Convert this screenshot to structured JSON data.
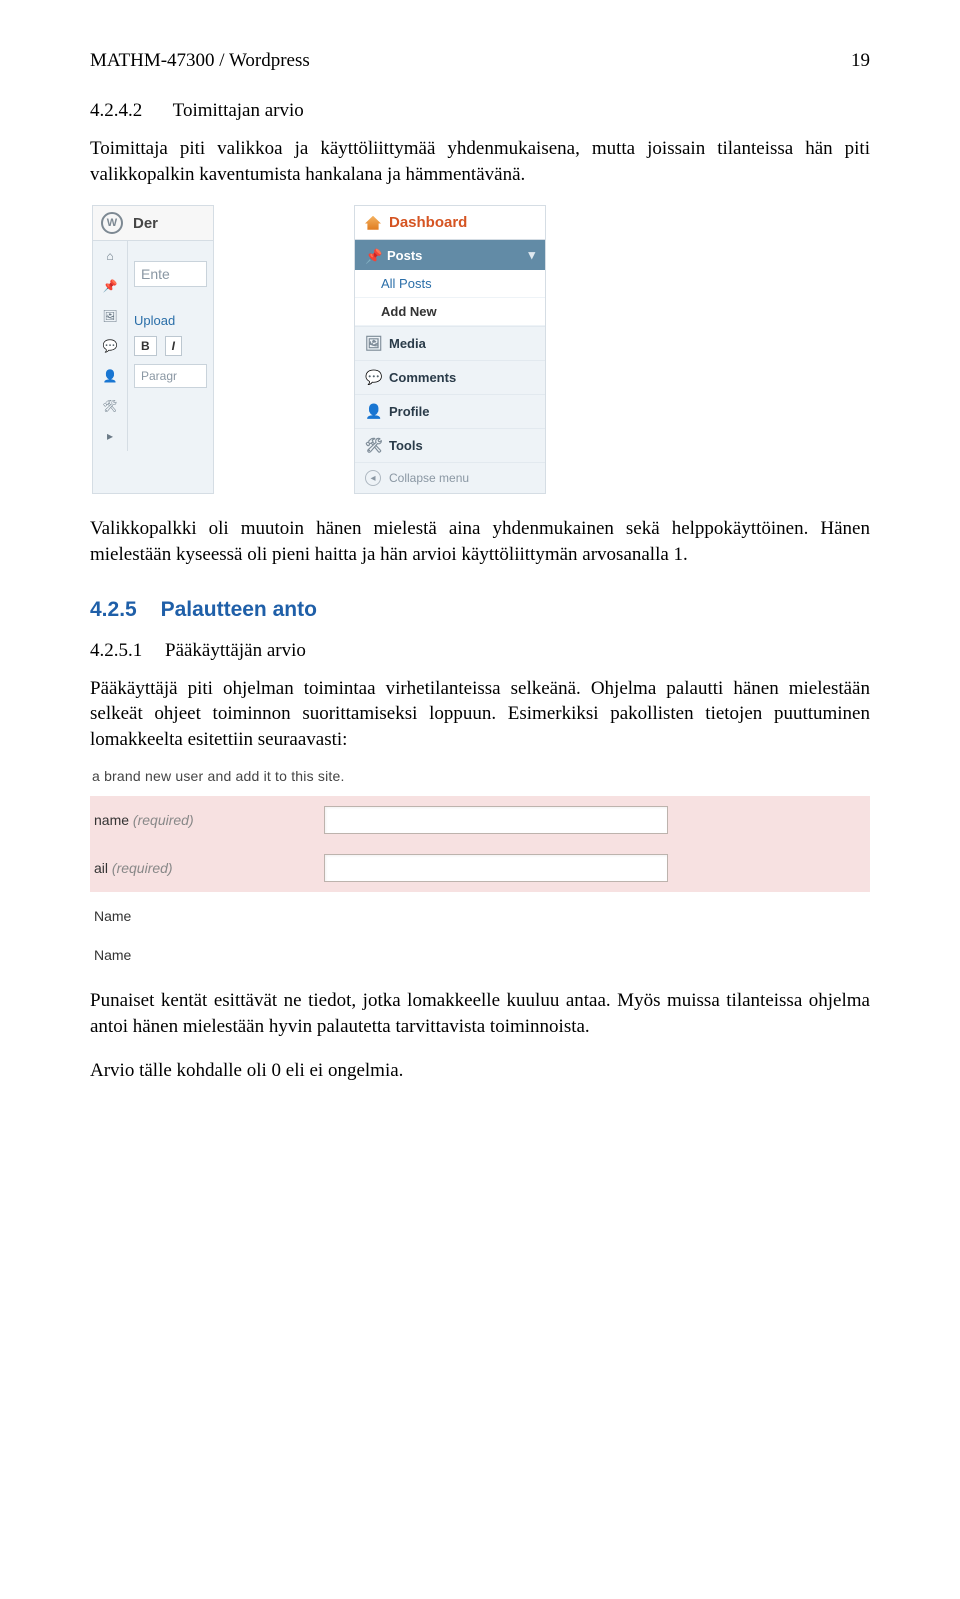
{
  "header": {
    "left": "MATHM-47300 / Wordpress",
    "right": "19"
  },
  "section1": {
    "num": "4.2.4.2",
    "title": "Toimittajan arvio",
    "p1": "Toimittaja piti valikkoa ja käyttöliittymää yhdenmukaisena, mutta joissain tilanteissa hän piti valikkopalkin kaventumista hankalana ja hämmentävänä."
  },
  "fig1": {
    "collapsed": {
      "topbar": "Der",
      "input1": "Ente",
      "linkUpload": "Upload",
      "btnB": "B",
      "btnI": "I",
      "select": "Paragr"
    },
    "expanded": {
      "dashboard": "Dashboard",
      "active": "Posts",
      "sub1": "All Posts",
      "sub2": "Add New",
      "items": [
        {
          "icon": "🖼",
          "label": "Media"
        },
        {
          "icon": "💬",
          "label": "Comments"
        },
        {
          "icon": "👤",
          "label": "Profile"
        },
        {
          "icon": "🛠",
          "label": "Tools"
        }
      ],
      "collapse": "Collapse menu"
    }
  },
  "mid": {
    "p1": "Valikkopalkki oli muutoin hänen mielestä aina yhdenmukainen sekä helppokäyttöinen. Hänen mielestään kyseessä oli pieni haitta ja hän arvioi käyttöliittymän arvosanalla 1."
  },
  "h2": {
    "num": "4.2.5",
    "title": "Palautteen anto"
  },
  "section2": {
    "num": "4.2.5.1",
    "title": "Pääkäyttäjän arvio",
    "p1": "Pääkäyttäjä piti ohjelman toimintaa virhetilanteissa selkeänä. Ohjelma palautti hänen mielestään selkeät ohjeet toiminnon suorittamiseksi loppuun. Esimerkiksi pakollisten tietojen puuttuminen lomakkeelta esitettiin seuraavasti:"
  },
  "fig2": {
    "intro": "a brand new user and add it to this site.",
    "rows": [
      {
        "label": "name",
        "required": true
      },
      {
        "label": "ail",
        "required": true
      },
      {
        "label": "Name",
        "required": false
      },
      {
        "label": "Name",
        "required": false
      }
    ],
    "requiredText": "(required)"
  },
  "tail": {
    "p1": "Punaiset kentät esittävät ne tiedot, jotka lomakkeelle kuuluu antaa. Myös muissa tilanteissa ohjelma antoi hänen mielestään hyvin palautetta tarvittavista toiminnoista.",
    "p2": "Arvio tälle kohdalle oli 0 eli ei ongelmia."
  }
}
